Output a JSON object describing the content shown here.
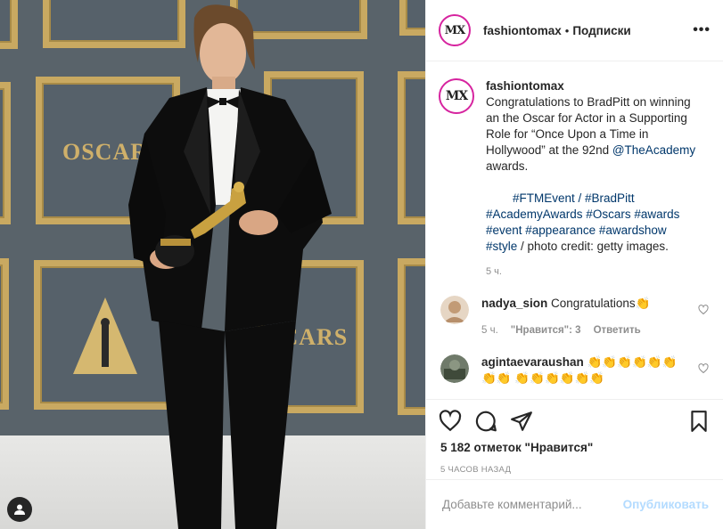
{
  "photo": {
    "oscars_text_left": "OSCARS",
    "oscars_text_right": "SCARS",
    "profile_chip_icon": "user-icon"
  },
  "header": {
    "username": "fashiontomax",
    "dot": "•",
    "follow_label": "Подписки",
    "more_label": "•••",
    "avatar_logo": "MX"
  },
  "caption": {
    "username": "fashiontomax",
    "text_lead": "      Congratulations to BradPitt on winning an the Oscar for Actor in a Supporting Role for “Once Upon a Time in Hollywood” at the 92nd ",
    "mention": "@TheAcademy",
    "text_tail": " awards.",
    "hashtags_line1_indent": "        ",
    "hashtags_1": "#FTMEvent / #BradPitt",
    "hashtags_2": "#AcademyAwards #Oscars #awards #event #appearance #awardshow #style",
    "credit": " / photo credit: getty images.",
    "time": "5 ч."
  },
  "comments": [
    {
      "username": "nadya_sion",
      "text": "Congratulations👏",
      "time": "5 ч.",
      "likes": "\"Нравится\": 3",
      "reply": "Ответить"
    },
    {
      "username": "agintaevaraushan",
      "text": "👏👏👏👏👏👏👏👏 👏👏👏👏👏👏"
    }
  ],
  "actions": {
    "like_icon": "heart-icon",
    "comment_icon": "comment-icon",
    "share_icon": "share-icon",
    "save_icon": "bookmark-icon",
    "likes_count": "5 182 отметок \"Нравится\"",
    "posted": "5 ЧАСОВ НАЗАД"
  },
  "add_comment": {
    "placeholder": "Добавьте комментарий...",
    "publish_label": "Опубликовать"
  }
}
